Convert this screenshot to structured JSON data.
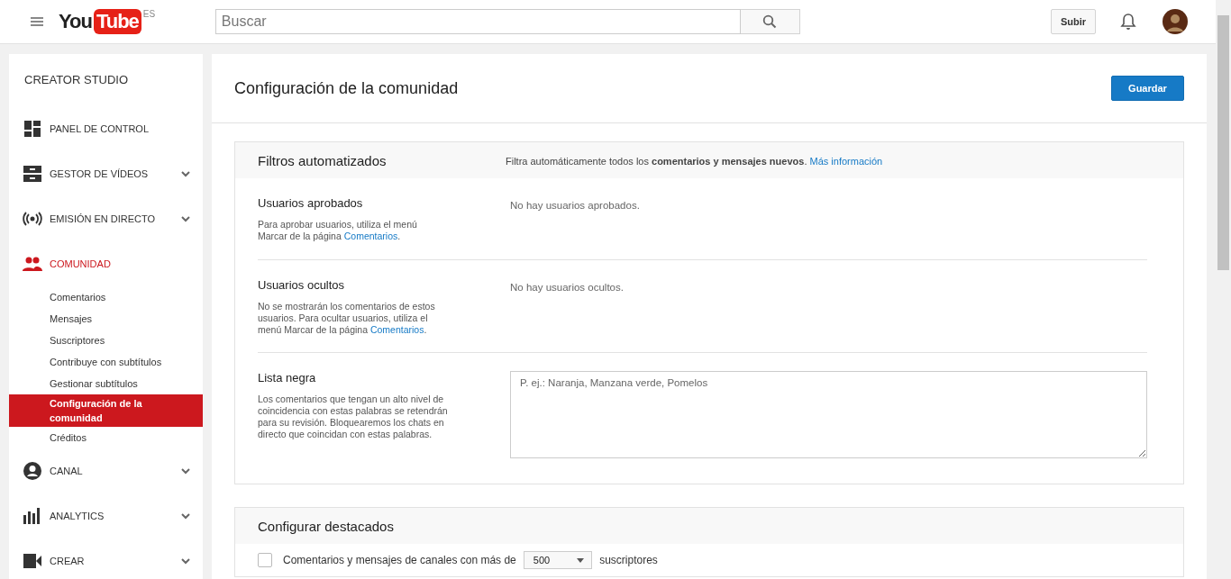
{
  "header": {
    "logo": "You",
    "logo_box": "Tube",
    "region": "ES",
    "search": {
      "placeholder": "Buscar"
    },
    "upload_button": "Subir"
  },
  "sidebar": {
    "title": "CREATOR STUDIO",
    "items": [
      {
        "kind": "dashboard",
        "label": "PANEL DE CONTROL",
        "expandable": false,
        "selected": false
      },
      {
        "kind": "videos",
        "label": "GESTOR DE VÍDEOS",
        "expandable": true,
        "selected": false
      },
      {
        "kind": "live",
        "label": "EMISIÓN EN DIRECTO",
        "expandable": true,
        "selected": false
      },
      {
        "kind": "community",
        "label": "COMUNIDAD",
        "expandable": false,
        "selected": true,
        "children": [
          {
            "label": "Comentarios",
            "selected": false
          },
          {
            "label": "Mensajes",
            "selected": false
          },
          {
            "label": "Suscriptores",
            "selected": false
          },
          {
            "label": "Contribuye con subtítulos",
            "selected": false
          },
          {
            "label": "Gestionar subtítulos",
            "selected": false
          },
          {
            "label": "Configuración de la comunidad",
            "selected": true
          },
          {
            "label": "Créditos",
            "selected": false
          }
        ]
      },
      {
        "kind": "channel",
        "label": "CANAL",
        "expandable": true,
        "selected": false
      },
      {
        "kind": "analytics",
        "label": "ANALYTICS",
        "expandable": true,
        "selected": false
      },
      {
        "kind": "create",
        "label": "CREAR",
        "expandable": true,
        "selected": false
      }
    ]
  },
  "main": {
    "title": "Configuración de la comunidad",
    "save_button": "Guardar",
    "filters": {
      "title": "Filtros automatizados",
      "description": "Filtra automáticamente todos los **comentarios y mensajes nuevos**.",
      "link": "Más información",
      "rows": [
        {
          "kind": "list",
          "title": "Usuarios aprobados",
          "help": "Para aprobar usuarios, utiliza el menú Marcar de la página",
          "help_link": "Comentarios",
          "help_end": ".",
          "value": "No hay usuarios aprobados."
        },
        {
          "kind": "list",
          "title": "Usuarios ocultos",
          "help": "No se mostrarán los comentarios de estos usuarios. Para ocultar usuarios, utiliza el menú Marcar de la página",
          "help_link": "Comentarios",
          "help_end": ".",
          "value": "No hay usuarios ocultos."
        },
        {
          "kind": "textarea",
          "title": "Lista negra",
          "help": "Los comentarios que tengan un alto nivel de coincidencia con estas palabras se retendrán para su revisión. Bloquearemos los chats en directo que coincidan con estas palabras.",
          "placeholder": "P. ej.: Naranja, Manzana verde, Pomelos"
        }
      ]
    },
    "highlights": {
      "title": "Configurar destacados",
      "option": {
        "checked": false,
        "label": "Comentarios y mensajes de canales con más de",
        "select": "500",
        "suffix": "suscriptores"
      }
    }
  }
}
